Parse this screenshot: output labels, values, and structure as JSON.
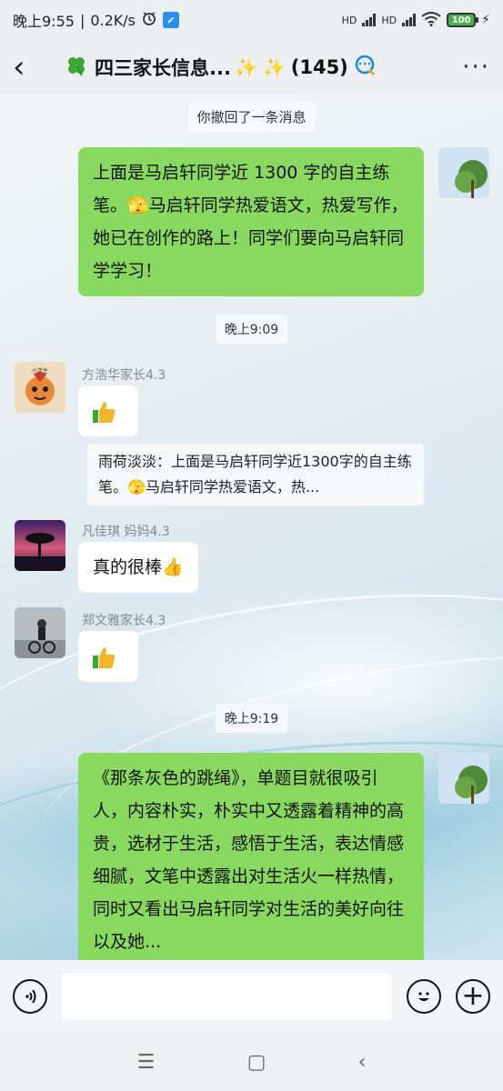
{
  "status_bar": {
    "time": "晚上9:55",
    "net_speed": "0.2K/s",
    "battery": "100",
    "sim_label": "HD"
  },
  "header": {
    "title": "四三家长信息...",
    "member_count": "(145)",
    "icons": [
      "clover-icon",
      "sparkle-icon",
      "sparkle-icon",
      "chat-bubble-icon"
    ]
  },
  "messages": {
    "system_recall": "你撤回了一条消息",
    "msg1_text": "上面是马启轩同学近 1300 字的自主练笔。🫣马启轩同学热爱语文，热爱写作，她已在创作的路上！同学们要向马启轩同学学习！",
    "time1": "晚上9:09",
    "sender2": "方浩华家长4.3",
    "sender2_avatar_label": "小学生",
    "sender2_text": "👍",
    "quote_text": "雨荷淡淡：上面是马启轩同学近1300字的自主练笔。🫣马启轩同学热爱语文，热...",
    "sender3": "凡佳琪  妈妈4.3",
    "sender3_text": "真的很棒👍",
    "sender4": "郑文雅家长4.3",
    "sender4_text": "👍",
    "time2": "晚上9:19",
    "msg5_text": "《那条灰色的跳绳》，单题目就很吸引人，内容朴实，朴实中又透露着精神的高贵，选材于生活，感悟于生活，表达情感细腻，文笔中透露出对生活火一样热情，同时又看出马启轩同学对生活的美好向往以及她..."
  },
  "input_bar": {
    "placeholder": ""
  },
  "colors": {
    "bubble_green": "#89d961",
    "bubble_white": "#ffffff",
    "status_bg": "#eceff2"
  }
}
